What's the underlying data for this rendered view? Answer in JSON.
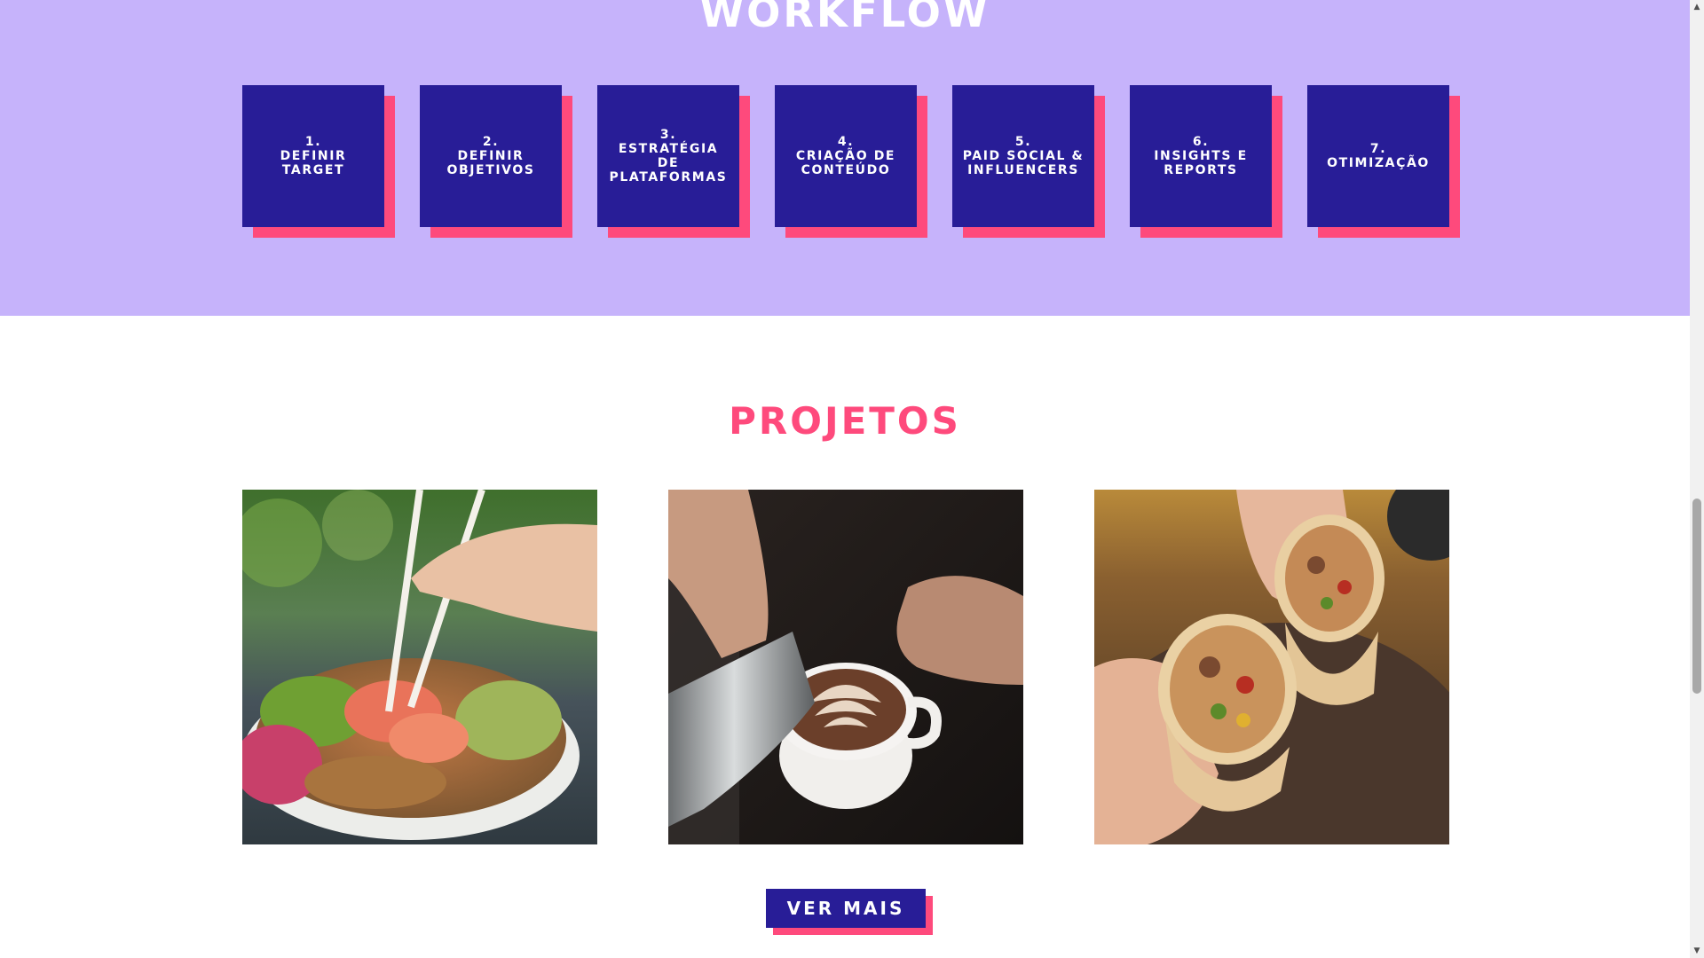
{
  "workflow": {
    "title": "WORKFLOW",
    "steps": [
      {
        "label": "1.\nDEFINIR\nTARGET"
      },
      {
        "label": "2.\nDEFINIR\nOBJETIVOS"
      },
      {
        "label": "3.\nESTRATÉGIA\nDE\nPLATAFORMAS"
      },
      {
        "label": "4.\nCRIAÇÃO DE\nCONTEÚDO"
      },
      {
        "label": "5.\nPAID SOCIAL &\nINFLUENCERS"
      },
      {
        "label": "6.\nINSIGHTS E\nREPORTS"
      },
      {
        "label": "7.\nOTIMIZAÇÃO"
      }
    ]
  },
  "projects": {
    "title": "PROJETOS",
    "images": [
      {
        "icon": "poke-bowl-photo"
      },
      {
        "icon": "latte-art-photo"
      },
      {
        "icon": "burrito-photo"
      }
    ],
    "button_label": "VER MAIS"
  },
  "scrollbar": {
    "up": "▲",
    "down": "▼"
  },
  "colors": {
    "band": "#c6b3fb",
    "card": "#281d97",
    "accent": "#fe4a7c",
    "white": "#ffffff"
  }
}
